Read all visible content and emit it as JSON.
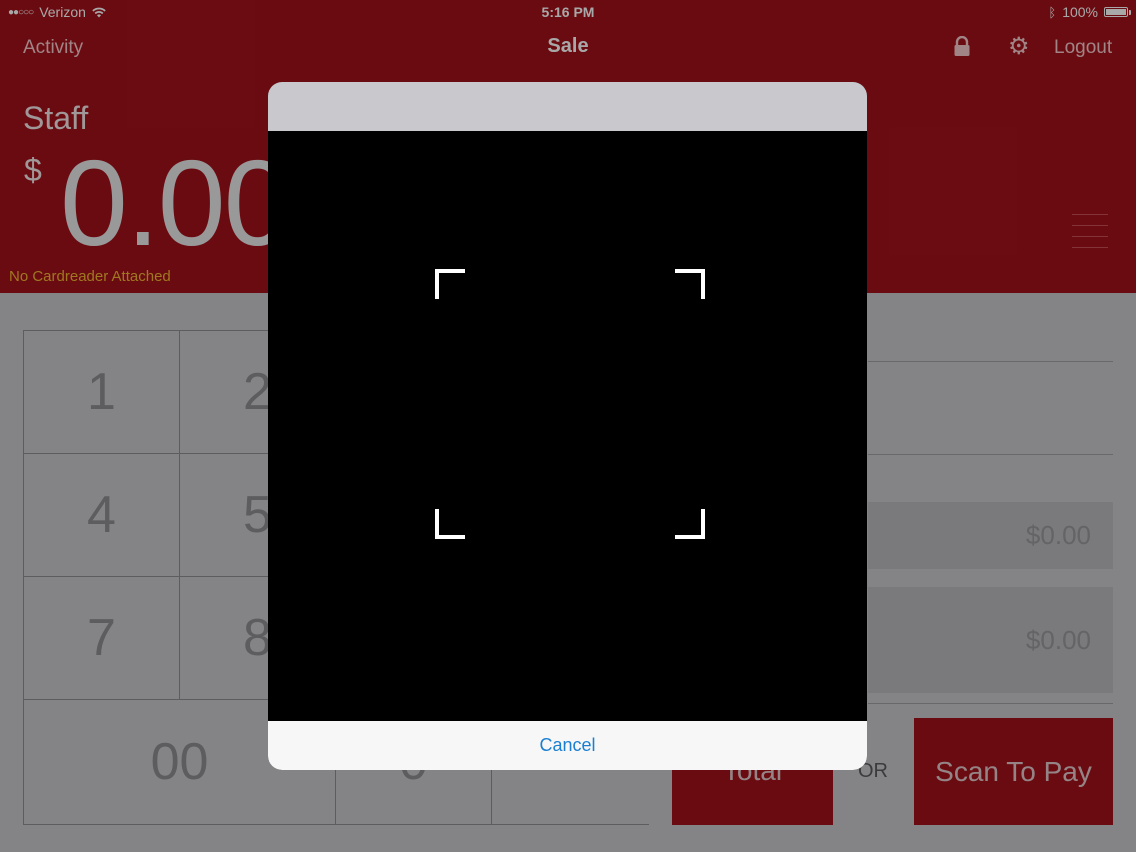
{
  "status_bar": {
    "carrier": "Verizon",
    "time": "5:16 PM",
    "battery": "100%",
    "battery_level": 1.0
  },
  "nav": {
    "activity": "Activity",
    "title": "Sale",
    "logout": "Logout"
  },
  "header": {
    "staff": "Staff",
    "currency_symbol": "$",
    "amount": "0.00",
    "cardreader_status": "No Cardreader Attached"
  },
  "keypad": {
    "keys": [
      "1",
      "2",
      "",
      "4",
      "5",
      "",
      "7",
      "8",
      "",
      "00",
      "0",
      ""
    ]
  },
  "summary": {
    "value_1": "$0.00",
    "value_2": "$0.00"
  },
  "actions": {
    "total": "Total",
    "or": "OR",
    "scan_to_pay": "Scan To Pay"
  },
  "scanner_modal": {
    "cancel": "Cancel"
  },
  "colors": {
    "brand_red": "#a1121a",
    "link_blue": "#1a7fd0",
    "warning_yellow": "#f2b632"
  }
}
